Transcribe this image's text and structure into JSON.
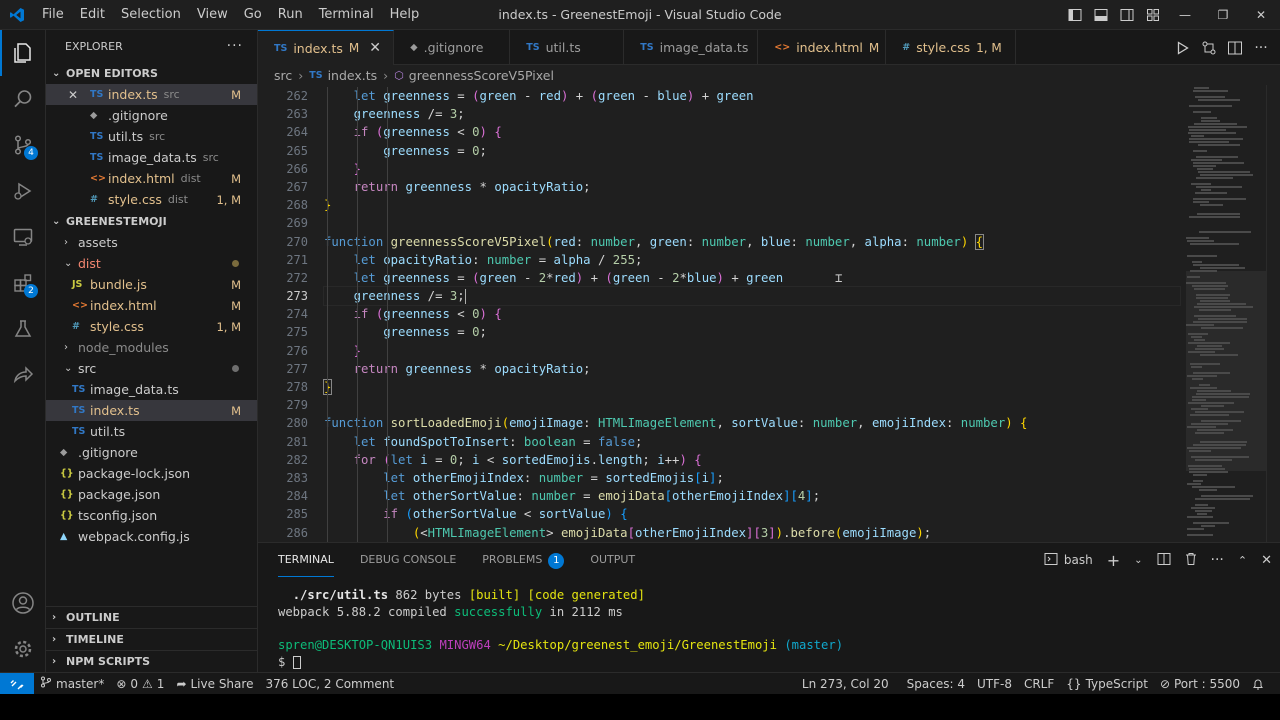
{
  "titlebar": {
    "menu": [
      "File",
      "Edit",
      "Selection",
      "View",
      "Go",
      "Run",
      "Terminal",
      "Help"
    ],
    "title": "index.ts - GreenestEmoji - Visual Studio Code"
  },
  "activity": {
    "source_control_badge": "4",
    "extensions_badge": "2"
  },
  "sidebar": {
    "title": "EXPLORER",
    "open_editors_label": "OPEN EDITORS",
    "open_editors": [
      {
        "icon": "TS",
        "name": "index.ts",
        "sub": "src",
        "status": "M"
      },
      {
        "icon": "",
        "name": ".gitignore",
        "sub": "",
        "status": ""
      },
      {
        "icon": "TS",
        "name": "util.ts",
        "sub": "src",
        "status": ""
      },
      {
        "icon": "TS",
        "name": "image_data.ts",
        "sub": "src",
        "status": ""
      },
      {
        "icon": "<>",
        "name": "index.html",
        "sub": "dist",
        "status": "M"
      },
      {
        "icon": "#",
        "name": "style.css",
        "sub": "dist",
        "status": "1, M"
      }
    ],
    "project_label": "GREENESTEMOJI",
    "tree": [
      {
        "icon": ">",
        "name": "assets",
        "status": ""
      },
      {
        "icon": "v",
        "name": "dist",
        "status": ""
      },
      {
        "icon": "JS",
        "name": "bundle.js",
        "status": "M"
      },
      {
        "icon": "<>",
        "name": "index.html",
        "status": "M"
      },
      {
        "icon": "#",
        "name": "style.css",
        "status": "1, M"
      },
      {
        "icon": ">",
        "name": "node_modules",
        "status": ""
      },
      {
        "icon": "v",
        "name": "src",
        "status": ""
      },
      {
        "icon": "TS",
        "name": "image_data.ts",
        "status": ""
      },
      {
        "icon": "TS",
        "name": "index.ts",
        "status": "M"
      },
      {
        "icon": "TS",
        "name": "util.ts",
        "status": ""
      },
      {
        "icon": "",
        "name": ".gitignore",
        "status": ""
      },
      {
        "icon": "{}",
        "name": "package-lock.json",
        "status": ""
      },
      {
        "icon": "{}",
        "name": "package.json",
        "status": ""
      },
      {
        "icon": "{}",
        "name": "tsconfig.json",
        "status": ""
      },
      {
        "icon": "",
        "name": "webpack.config.js",
        "status": ""
      }
    ],
    "outline_label": "OUTLINE",
    "timeline_label": "TIMELINE",
    "npm_label": "NPM SCRIPTS"
  },
  "tabs": [
    {
      "icon": "TS",
      "label": "index.ts",
      "mark": "M"
    },
    {
      "icon": "",
      "label": ".gitignore",
      "mark": ""
    },
    {
      "icon": "TS",
      "label": "util.ts",
      "mark": ""
    },
    {
      "icon": "TS",
      "label": "image_data.ts",
      "mark": ""
    },
    {
      "icon": "<>",
      "label": "index.html",
      "mark": "M"
    },
    {
      "icon": "#",
      "label": "style.css",
      "mark": "1, M"
    }
  ],
  "breadcrumb": {
    "folder": "src",
    "icon": "TS",
    "file": "index.ts",
    "symbol": "greennessScoreV5Pixel"
  },
  "editor": {
    "line_numbers": [
      "262",
      "263",
      "264",
      "265",
      "266",
      "267",
      "268",
      "269",
      "270",
      "271",
      "272",
      "273",
      "274",
      "275",
      "276",
      "277",
      "278",
      "279",
      "280",
      "281",
      "282",
      "283",
      "284",
      "285",
      "286"
    ],
    "current_line": "273"
  },
  "panel": {
    "tabs": [
      "TERMINAL",
      "DEBUG CONSOLE",
      "PROBLEMS",
      "OUTPUT"
    ],
    "problems_count": "1",
    "shell": "bash",
    "terminal": {
      "l1_path": "./src/util.ts",
      "l1_size": "862 bytes",
      "l1_built": "[built]",
      "l1_gen": "[code generated]",
      "l2_a": "webpack 5.88.2 compiled",
      "l2_ok": "successfully",
      "l2_b": "in 2112 ms",
      "prompt_user": "spren@DESKTOP-QN1UIS3",
      "prompt_env": "MINGW64",
      "prompt_path": "~/Desktop/greenest_emoji/GreenestEmoji",
      "prompt_branch": "(master)",
      "prompt_symbol": "$"
    }
  },
  "status": {
    "branch": "master*",
    "errors": "0",
    "warnings": "1",
    "live_share": "Live Share",
    "loc": "376 LOC, 2 Comment",
    "position": "Ln 273, Col 20",
    "spaces": "Spaces: 4",
    "encoding": "UTF-8",
    "eol": "CRLF",
    "language": "TypeScript",
    "port": "Port : 5500"
  }
}
